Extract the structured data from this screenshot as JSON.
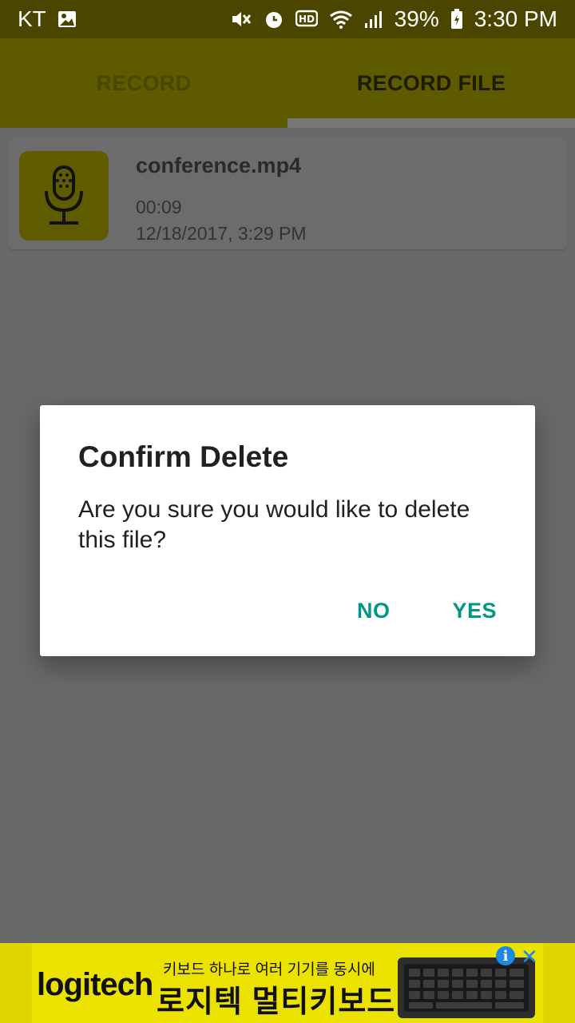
{
  "status_bar": {
    "carrier": "KT",
    "battery": "39%",
    "time": "3:30 PM",
    "icons": [
      "image-icon",
      "mute-icon",
      "alarm-icon",
      "hd-icon",
      "wifi-icon",
      "signal-icon",
      "battery-icon"
    ]
  },
  "tabs": [
    {
      "label": "RECORD",
      "selected": false
    },
    {
      "label": "RECORD FILE",
      "selected": true
    }
  ],
  "files": [
    {
      "name": "conference.mp4",
      "duration": "00:09",
      "date": "12/18/2017, 3:29 PM",
      "icon": "microphone-icon"
    }
  ],
  "dialog": {
    "title": "Confirm Delete",
    "message": "Are you sure you would like to delete this file?",
    "no_label": "NO",
    "yes_label": "YES"
  },
  "ad": {
    "brand": "logitech",
    "line1": "키보드 하나로 여러 기기를 동시에",
    "line2": "로지텍 멀티키보드",
    "info_icon": "i",
    "close_icon": "✕"
  },
  "colors": {
    "primary": "#e0d600",
    "accent": "#009688"
  }
}
